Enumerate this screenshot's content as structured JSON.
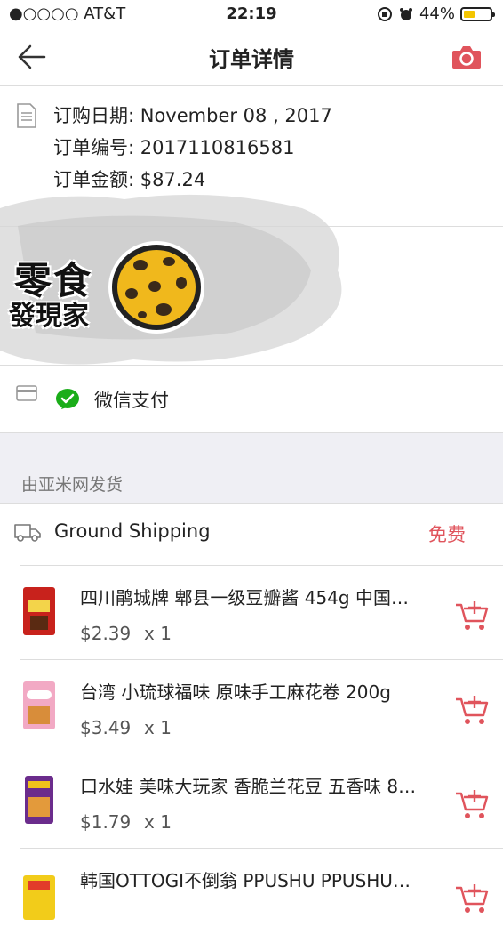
{
  "status_bar": {
    "carrier": "●○○○○ AT&T",
    "time": "22:19",
    "battery": "44%",
    "battery_level": 0.44
  },
  "nav": {
    "title": "订单详情"
  },
  "order": {
    "date_line": "订购日期: November 08 , 2017",
    "number_line": "订单编号: 2017110816581",
    "amount_line": "订单金额: $87.24"
  },
  "logo": {
    "line1": "零食",
    "line2": "發現家"
  },
  "payment": {
    "method": "微信支付"
  },
  "shipper": {
    "label": "由亚米网发货"
  },
  "shipping": {
    "method": "Ground Shipping",
    "fee": "免费"
  },
  "items": [
    {
      "name": "四川鹃城牌 郫县一级豆瓣酱 454g 中国…",
      "price": "$2.39",
      "qty": "x 1"
    },
    {
      "name": "台湾 小琉球福味 原味手工麻花卷 200g",
      "price": "$3.49",
      "qty": "x 1"
    },
    {
      "name": "口水娃 美味大玩家 香脆兰花豆 五香味 8…",
      "price": "$1.79",
      "qty": "x 1"
    },
    {
      "name": "韩国OTTOGI不倒翁 PPUSHU PPUSHU…",
      "price": "",
      "qty": ""
    }
  ],
  "colors": {
    "accent": "#e0545c",
    "wechat": "#1aad19",
    "band": "#efeff4"
  }
}
